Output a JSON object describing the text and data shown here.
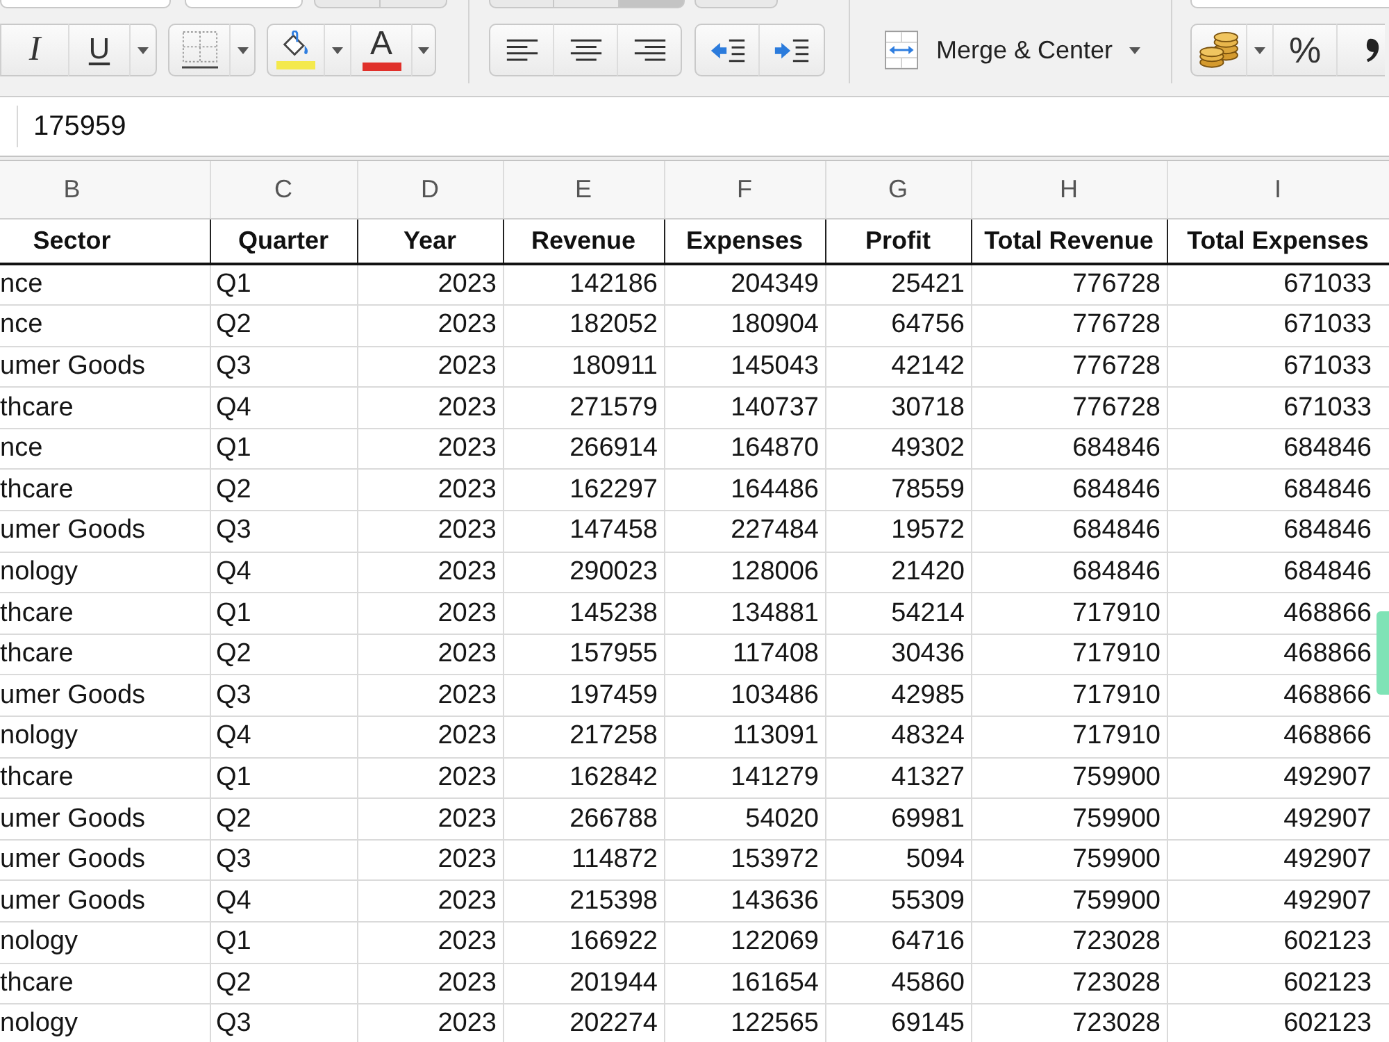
{
  "toolbar": {
    "top_button_groups": [
      [
        {
          "selected": false
        },
        {
          "selected": false
        }
      ],
      [
        {
          "selected": false
        },
        {
          "selected": false
        },
        {
          "selected": true
        }
      ],
      [
        {
          "selected": false
        }
      ]
    ],
    "style_buttons": [
      {
        "kind": "italic",
        "label": "I"
      },
      {
        "kind": "underline",
        "label": "U"
      }
    ],
    "color_buttons": [
      {
        "kind": "fill",
        "color": "#f4e94c"
      },
      {
        "kind": "font",
        "label": "A",
        "color": "#e0302a"
      }
    ],
    "merge_button": {
      "label": "Merge & Center"
    },
    "number_buttons": [
      {
        "kind": "currency"
      },
      {
        "kind": "percent",
        "label": "%"
      },
      {
        "kind": "comma"
      }
    ]
  },
  "formula_bar": {
    "value": "175959"
  },
  "sheet": {
    "column_letters": [
      "B",
      "C",
      "D",
      "E",
      "F",
      "G",
      "H",
      "I"
    ],
    "columns": [
      "Sector",
      "Quarter",
      "Year",
      "Revenue",
      "Expenses",
      "Profit",
      "Total Revenue",
      "Total Expenses"
    ],
    "rows": [
      [
        "nce",
        "Q1",
        "2023",
        "142186",
        "204349",
        "25421",
        "776728",
        "671033"
      ],
      [
        "nce",
        "Q2",
        "2023",
        "182052",
        "180904",
        "64756",
        "776728",
        "671033"
      ],
      [
        "umer Goods",
        "Q3",
        "2023",
        "180911",
        "145043",
        "42142",
        "776728",
        "671033"
      ],
      [
        "thcare",
        "Q4",
        "2023",
        "271579",
        "140737",
        "30718",
        "776728",
        "671033"
      ],
      [
        "nce",
        "Q1",
        "2023",
        "266914",
        "164870",
        "49302",
        "684846",
        "684846"
      ],
      [
        "thcare",
        "Q2",
        "2023",
        "162297",
        "164486",
        "78559",
        "684846",
        "684846"
      ],
      [
        "umer Goods",
        "Q3",
        "2023",
        "147458",
        "227484",
        "19572",
        "684846",
        "684846"
      ],
      [
        "nology",
        "Q4",
        "2023",
        "290023",
        "128006",
        "21420",
        "684846",
        "684846"
      ],
      [
        "thcare",
        "Q1",
        "2023",
        "145238",
        "134881",
        "54214",
        "717910",
        "468866"
      ],
      [
        "thcare",
        "Q2",
        "2023",
        "157955",
        "117408",
        "30436",
        "717910",
        "468866"
      ],
      [
        "umer Goods",
        "Q3",
        "2023",
        "197459",
        "103486",
        "42985",
        "717910",
        "468866"
      ],
      [
        "nology",
        "Q4",
        "2023",
        "217258",
        "113091",
        "48324",
        "717910",
        "468866"
      ],
      [
        "thcare",
        "Q1",
        "2023",
        "162842",
        "141279",
        "41327",
        "759900",
        "492907"
      ],
      [
        "umer Goods",
        "Q2",
        "2023",
        "266788",
        "54020",
        "69981",
        "759900",
        "492907"
      ],
      [
        "umer Goods",
        "Q3",
        "2023",
        "114872",
        "153972",
        "5094",
        "759900",
        "492907"
      ],
      [
        "umer Goods",
        "Q4",
        "2023",
        "215398",
        "143636",
        "55309",
        "759900",
        "492907"
      ],
      [
        "nology",
        "Q1",
        "2023",
        "166922",
        "122069",
        "64716",
        "723028",
        "602123"
      ],
      [
        "thcare",
        "Q2",
        "2023",
        "201944",
        "161654",
        "45860",
        "723028",
        "602123"
      ],
      [
        "nology",
        "Q3",
        "2023",
        "202274",
        "122565",
        "69145",
        "723028",
        "602123"
      ]
    ]
  }
}
